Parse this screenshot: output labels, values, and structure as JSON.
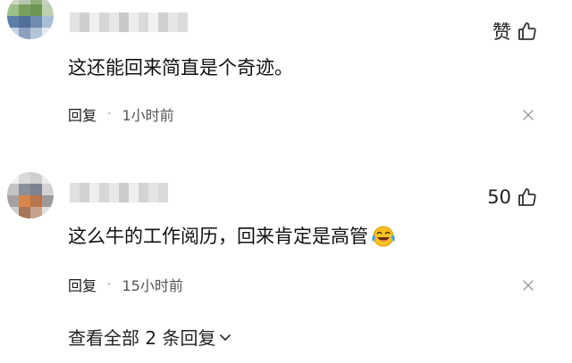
{
  "comments": [
    {
      "username": "",
      "like_label": "赞",
      "text": "这还能回来简直是个奇迹。",
      "reply_label": "回复",
      "separator": "·",
      "time": "1小时前"
    },
    {
      "username": "",
      "like_label": "50",
      "text": "这么牛的工作阅历，回来肯定是高管",
      "emoji": "laughing-crying-emoji",
      "reply_label": "回复",
      "separator": "·",
      "time": "15小时前",
      "view_replies_label": "查看全部 2 条回复"
    }
  ],
  "icons": {
    "like": "thumbs-up-icon",
    "close": "close-icon",
    "expand": "chevron-down-icon"
  },
  "colors": {
    "text": "#111111",
    "secondary": "#555555",
    "icon": "#333333",
    "emoji": "#f7b500"
  }
}
